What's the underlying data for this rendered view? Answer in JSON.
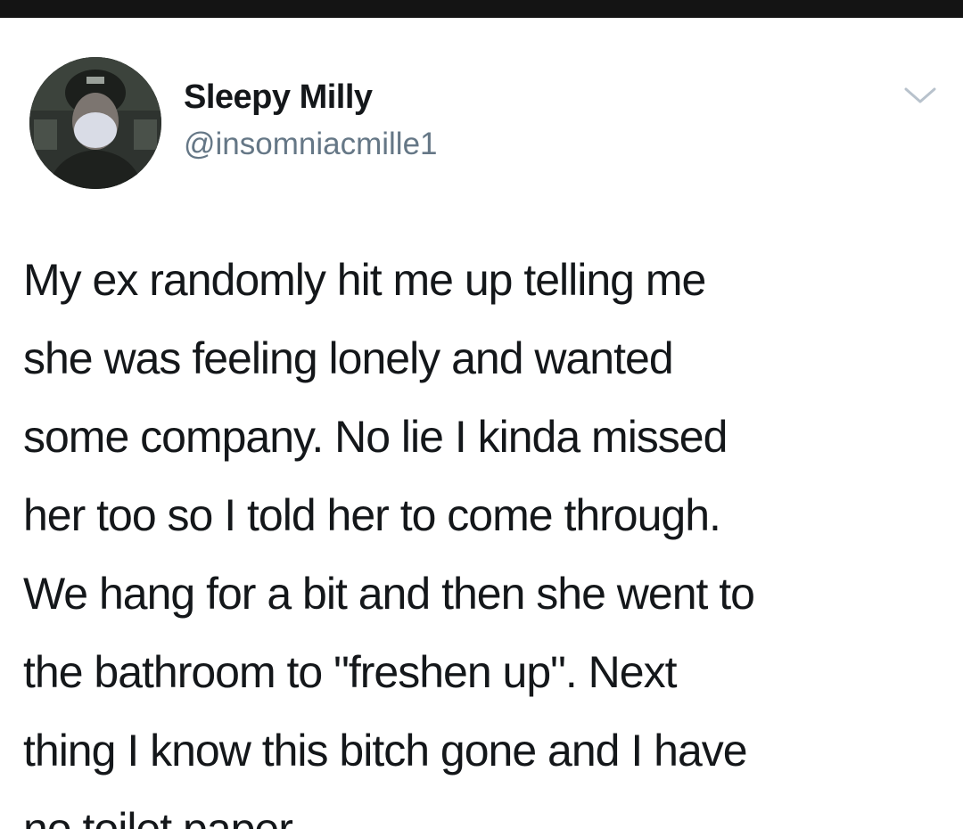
{
  "tweet": {
    "author": {
      "display_name": "Sleepy Milly",
      "handle": "@insomniacmille1",
      "avatar_icon": "user-avatar-masked-person"
    },
    "menu_icon": "chevron-down-icon",
    "text_lines": [
      "My ex randomly hit me up telling me",
      "she was feeling lonely and wanted",
      "some company. No lie I kinda missed",
      "her too so I told her to come through.",
      "We hang for a bit and then she went to",
      "the bathroom to \"freshen up\". Next",
      "thing I know this bitch gone and I have",
      "no toilet paper"
    ]
  },
  "colors": {
    "top_bar": "#141414",
    "text": "#14171a",
    "handle": "#657786",
    "chevron": "#b8c2cc"
  }
}
